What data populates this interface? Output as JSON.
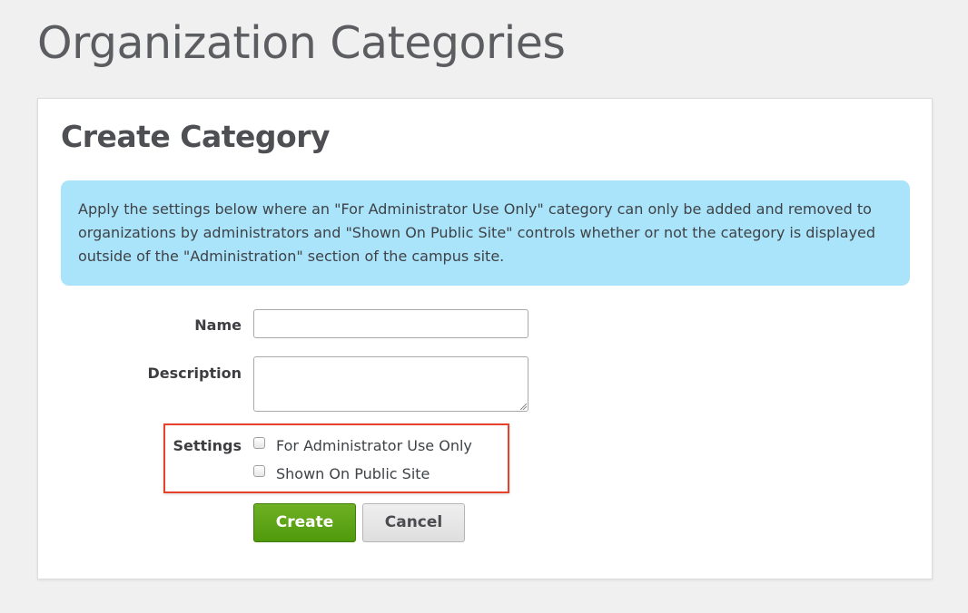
{
  "page": {
    "title": "Organization Categories"
  },
  "card": {
    "title": "Create Category",
    "info_text": "Apply the settings below where an \"For Administrator Use Only\" category can only be added and removed to organizations by administrators and \"Shown On Public Site\" controls whether or not the category is displayed outside of the \"Administration\" section of the campus site."
  },
  "form": {
    "name_label": "Name",
    "name_value": "",
    "description_label": "Description",
    "description_value": "",
    "settings_label": "Settings",
    "settings": [
      {
        "label": "For Administrator Use Only",
        "checked": false
      },
      {
        "label": "Shown On Public Site",
        "checked": false
      }
    ],
    "create_label": "Create",
    "cancel_label": "Cancel"
  },
  "colors": {
    "page_background": "#f0f0f0",
    "info_background": "#aae4fa",
    "create_button": "#5ea419",
    "highlight_border": "#e8412b"
  }
}
